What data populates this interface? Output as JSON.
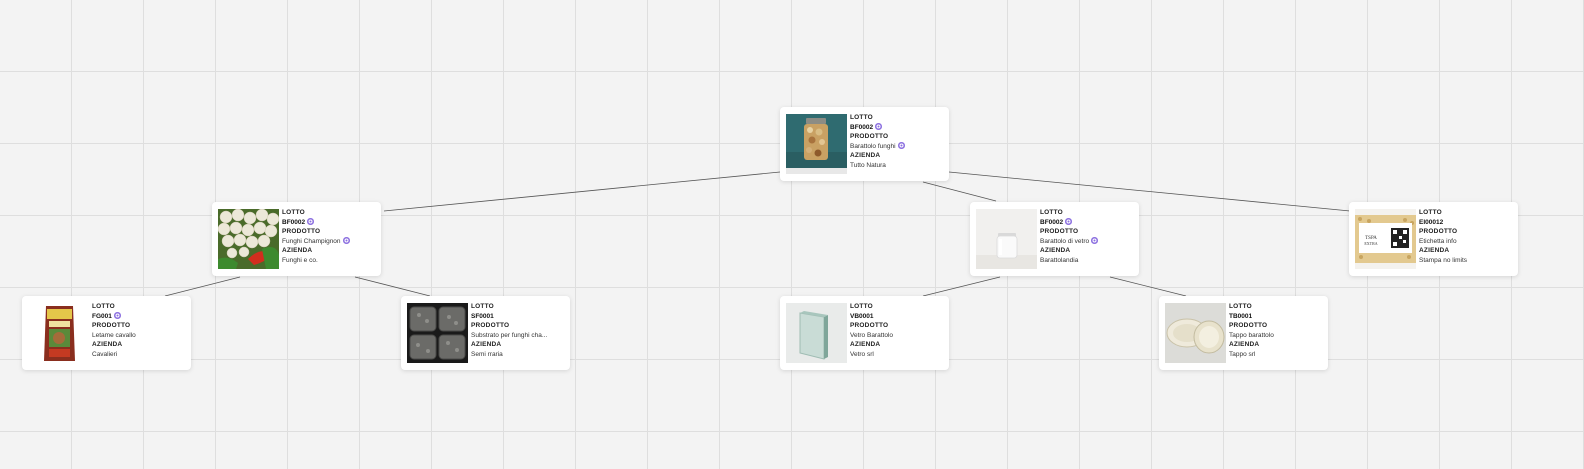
{
  "labels": {
    "lot": "LOTTO",
    "product": "PRODOTTO",
    "company": "AZIENDA"
  },
  "colors": {
    "canvas": "#f3f3f3",
    "grid": "#dedede",
    "verified_badge": "#8b6fe0",
    "edge": "#555555"
  },
  "nodes": {
    "root": {
      "lot": "BF0002",
      "product": "Barattolo funghi",
      "company": "Tutto Natura",
      "lot_verified": true,
      "product_verified": true,
      "image": "jar-of-mushrooms"
    },
    "mushrooms": {
      "lot": "BF0002",
      "product": "Funghi Champignon",
      "company": "Funghi e co.",
      "lot_verified": true,
      "product_verified": true,
      "image": "white-mushrooms"
    },
    "jar": {
      "lot": "BF0002",
      "product": "Barattolo di vetro",
      "company": "Barattolandia",
      "lot_verified": true,
      "product_verified": true,
      "image": "glass-jar"
    },
    "label": {
      "lot": "EI00012",
      "product": "Etichetta info",
      "company": "Stampa no limits",
      "lot_verified": false,
      "product_verified": false,
      "image": "label-with-qr"
    },
    "manure": {
      "lot": "FG001",
      "product": "Letame cavallo",
      "company": "Cavalieri",
      "lot_verified": true,
      "product_verified": false,
      "image": "manure-bag"
    },
    "substrate": {
      "lot": "SF0001",
      "product": "Substrato per funghi cha...",
      "company": "Semi rraria",
      "lot_verified": false,
      "product_verified": false,
      "image": "substrate-blocks"
    },
    "glass": {
      "lot": "VB0001",
      "product": "Vetro Barattolo",
      "company": "Vetro srl",
      "lot_verified": false,
      "product_verified": false,
      "image": "glass-sheet"
    },
    "cap": {
      "lot": "TB0001",
      "product": "Tappo barattolo",
      "company": "Tappo srl",
      "lot_verified": false,
      "product_verified": false,
      "image": "jar-cap"
    }
  },
  "edges": [
    [
      "root",
      "mushrooms"
    ],
    [
      "root",
      "jar"
    ],
    [
      "root",
      "label"
    ],
    [
      "mushrooms",
      "manure"
    ],
    [
      "mushrooms",
      "substrate"
    ],
    [
      "jar",
      "glass"
    ],
    [
      "jar",
      "cap"
    ]
  ]
}
